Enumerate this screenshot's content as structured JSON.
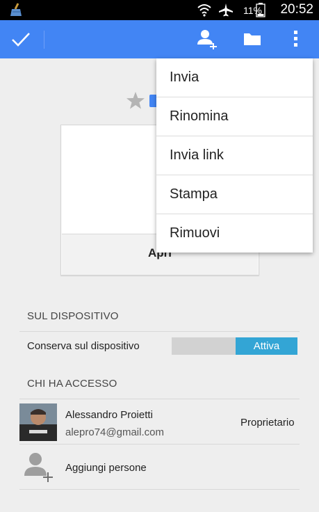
{
  "status_bar": {
    "battery_percent": "11%",
    "time": "20:52",
    "icons": [
      "broom-app-icon",
      "wifi-icon",
      "airplane-icon",
      "battery-icon"
    ]
  },
  "action_bar": {
    "color": "#4285f4",
    "icons": [
      "checkmark-icon",
      "add-person-icon",
      "folder-icon",
      "overflow-menu-icon"
    ]
  },
  "file_card": {
    "title": "Apri",
    "icons": [
      "star-icon",
      "doc-icon"
    ]
  },
  "on_device": {
    "header": "SUL DISPOSITIVO",
    "label": "Conserva sul dispositivo",
    "toggle_state": "Attiva",
    "toggle_color": "#33a5d5"
  },
  "access": {
    "header": "CHI HA ACCESSO",
    "owner": {
      "name": "Alessandro Proietti",
      "email": "alepro74@gmail.com",
      "role": "Proprietario"
    },
    "add_people": "Aggiungi persone"
  },
  "menu": {
    "items": [
      "Invia",
      "Rinomina",
      "Invia link",
      "Stampa",
      "Rimuovi"
    ]
  }
}
